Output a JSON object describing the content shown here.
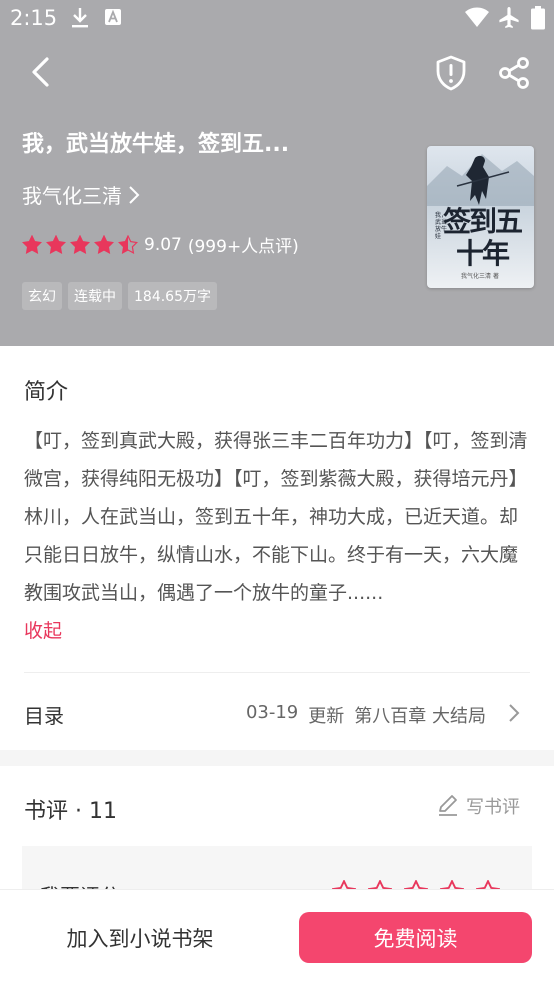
{
  "status_bar": {
    "time": "2:15"
  },
  "book": {
    "title": "我，武当放牛娃，签到五...",
    "author": "我气化三清",
    "rating_score": "9.07",
    "rating_count": "(999+人点评)",
    "rating_value": 4.5,
    "rating_max": 5,
    "tags": [
      "玄幻",
      "连载中",
      "184.65万字"
    ],
    "cover": {
      "title": "签到五十年",
      "subtitle": "我，武当放牛娃",
      "author_line": "我气化三清 著"
    }
  },
  "intro": {
    "title": "简介",
    "text": "【叮，签到真武大殿，获得张三丰二百年功力】【叮，签到清微宫，获得纯阳无极功】【叮，签到紫薇大殿，获得培元丹】林川，人在武当山，签到五十年，神功大成，已近天道。却只能日日放牛，纵情山水，不能下山。终于有一天，六大魔教围攻武当山，偶遇了一个放牛的童子......",
    "collapse_label": "收起"
  },
  "toc": {
    "label": "目录",
    "date": "03-19",
    "update_label": "更新",
    "latest_chapter": "第八百章 大结局"
  },
  "reviews": {
    "title": "书评 · 11",
    "write_label": "写书评",
    "rate_label": "我要评分"
  },
  "actions": {
    "add_shelf": "加入到小说书架",
    "read_free": "免费阅读"
  },
  "colors": {
    "header_bg": "#aaaaad",
    "accent": "#f4466e",
    "star": "#e8375c"
  }
}
